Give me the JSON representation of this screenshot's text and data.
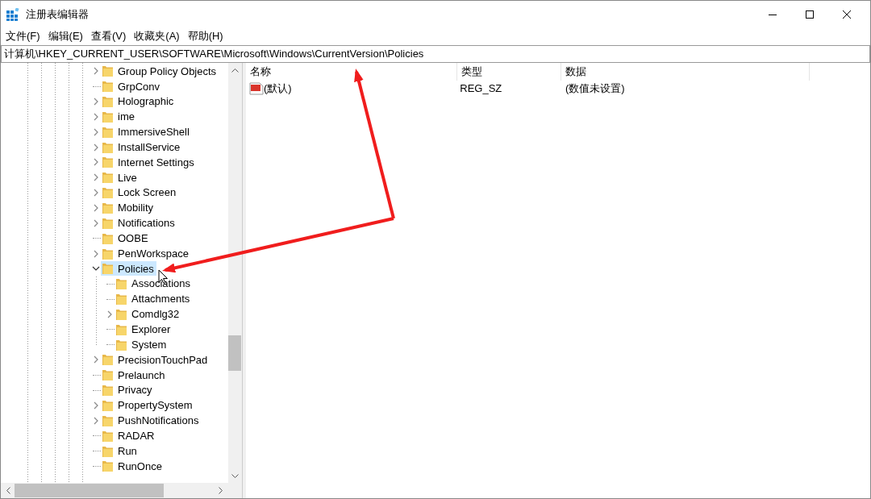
{
  "window": {
    "title": "注册表编辑器",
    "controls": [
      {
        "kind": "minimize"
      },
      {
        "kind": "maximize"
      },
      {
        "kind": "close"
      }
    ]
  },
  "menu": [
    "文件(F)",
    "编辑(E)",
    "查看(V)",
    "收藏夹(A)",
    "帮助(H)"
  ],
  "address": "计算机\\HKEY_CURRENT_USER\\SOFTWARE\\Microsoft\\Windows\\CurrentVersion\\Policies",
  "tree": [
    {
      "label": "Group Policy Objects",
      "expandable": true,
      "expanded": false,
      "selected": false
    },
    {
      "label": "GrpConv",
      "expandable": false,
      "expanded": false,
      "selected": false
    },
    {
      "label": "Holographic",
      "expandable": true,
      "expanded": false,
      "selected": false
    },
    {
      "label": "ime",
      "expandable": true,
      "expanded": false,
      "selected": false
    },
    {
      "label": "ImmersiveShell",
      "expandable": true,
      "expanded": false,
      "selected": false
    },
    {
      "label": "InstallService",
      "expandable": true,
      "expanded": false,
      "selected": false
    },
    {
      "label": "Internet Settings",
      "expandable": true,
      "expanded": false,
      "selected": false
    },
    {
      "label": "Live",
      "expandable": true,
      "expanded": false,
      "selected": false
    },
    {
      "label": "Lock Screen",
      "expandable": true,
      "expanded": false,
      "selected": false
    },
    {
      "label": "Mobility",
      "expandable": true,
      "expanded": false,
      "selected": false
    },
    {
      "label": "Notifications",
      "expandable": true,
      "expanded": false,
      "selected": false
    },
    {
      "label": "OOBE",
      "expandable": false,
      "expanded": false,
      "selected": false
    },
    {
      "label": "PenWorkspace",
      "expandable": true,
      "expanded": false,
      "selected": false
    },
    {
      "label": "Policies",
      "expandable": true,
      "expanded": true,
      "selected": true,
      "children": [
        {
          "label": "Associations",
          "expandable": false,
          "expanded": false,
          "selected": false
        },
        {
          "label": "Attachments",
          "expandable": false,
          "expanded": false,
          "selected": false
        },
        {
          "label": "Comdlg32",
          "expandable": true,
          "expanded": false,
          "selected": false
        },
        {
          "label": "Explorer",
          "expandable": false,
          "expanded": false,
          "selected": false
        },
        {
          "label": "System",
          "expandable": false,
          "expanded": false,
          "selected": false
        }
      ]
    },
    {
      "label": "PrecisionTouchPad",
      "expandable": true,
      "expanded": false,
      "selected": false
    },
    {
      "label": "Prelaunch",
      "expandable": false,
      "expanded": false,
      "selected": false
    },
    {
      "label": "Privacy",
      "expandable": false,
      "expanded": false,
      "selected": false
    },
    {
      "label": "PropertySystem",
      "expandable": true,
      "expanded": false,
      "selected": false
    },
    {
      "label": "PushNotifications",
      "expandable": true,
      "expanded": false,
      "selected": false
    },
    {
      "label": "RADAR",
      "expandable": false,
      "expanded": false,
      "selected": false
    },
    {
      "label": "Run",
      "expandable": false,
      "expanded": false,
      "selected": false
    },
    {
      "label": "RunOnce",
      "expandable": false,
      "expanded": false,
      "selected": false
    }
  ],
  "values": {
    "columns": [
      "名称",
      "类型",
      "数据"
    ],
    "rows": [
      {
        "name": "(默认)",
        "type": "REG_SZ",
        "data": "(数值未设置)"
      }
    ]
  }
}
